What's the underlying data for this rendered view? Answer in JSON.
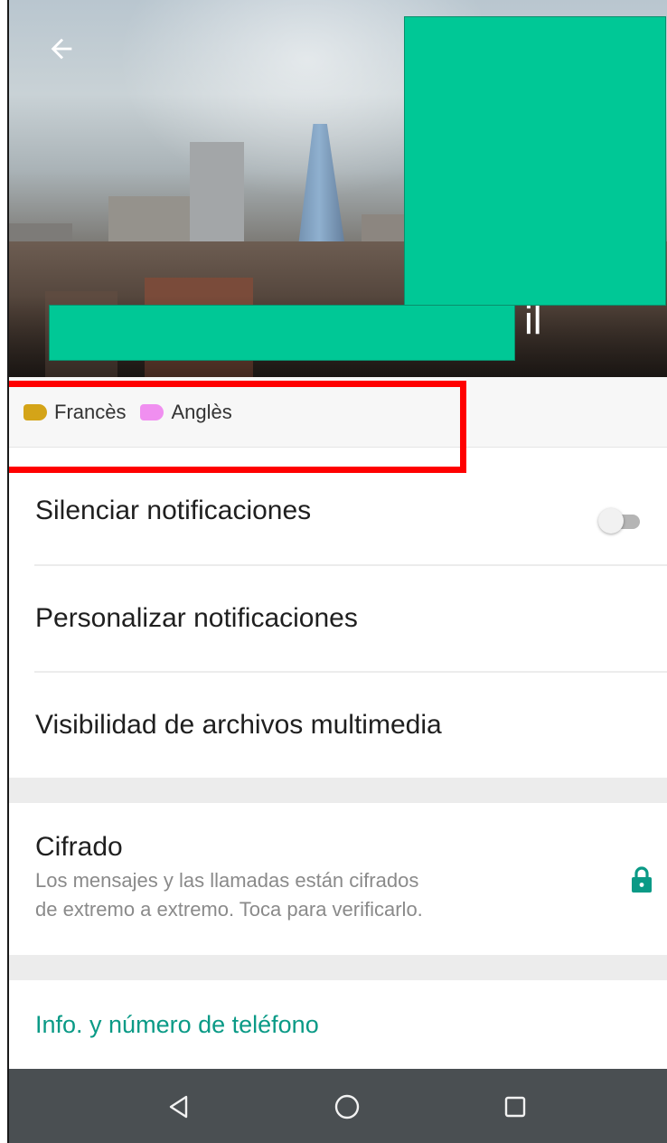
{
  "header": {
    "contact_name_visible_end": "il",
    "back_icon": "arrow-left-icon"
  },
  "labels": [
    {
      "name": "Francès",
      "color": "#d4a418"
    },
    {
      "name": "Anglès",
      "color": "#f08ff0"
    }
  ],
  "settings": {
    "mute_label": "Silenciar notificaciones",
    "mute_enabled": false,
    "custom_label": "Personalizar notificaciones",
    "media_label": "Visibilidad de archivos multimedia"
  },
  "encryption": {
    "title": "Cifrado",
    "line1": "Los mensajes y las llamadas están cifrados",
    "line2": "de extremo a extremo. Toca para verificarlo.",
    "icon": "lock-icon",
    "accent": "#0a9a86"
  },
  "info": {
    "link_label": "Info. y número de teléfono"
  },
  "navbar": {
    "buttons": [
      "back-triangle-icon",
      "home-circle-icon",
      "recents-square-icon"
    ]
  },
  "colors": {
    "redaction": "#00c896",
    "highlight": "#ff0000",
    "navbar": "#4a4f52"
  }
}
